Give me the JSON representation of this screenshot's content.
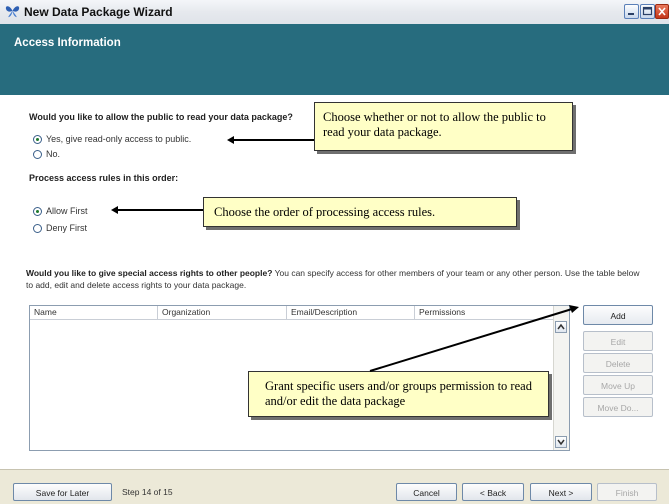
{
  "window": {
    "title": "New Data Package Wizard"
  },
  "header": {
    "title": "Access Information"
  },
  "public_access": {
    "question": "Would you like to allow the public to read your data package?",
    "options": [
      {
        "label": "Yes, give read-only access to public.",
        "checked": true
      },
      {
        "label": "No.",
        "checked": false
      }
    ]
  },
  "rule_order": {
    "question": "Process access rules in this order:",
    "options": [
      {
        "label": "Allow First",
        "checked": true
      },
      {
        "label": "Deny First",
        "checked": false
      }
    ]
  },
  "special_access": {
    "question": "Would you like to give special access rights to other people?",
    "description": " You can specify access for other members of your team or any other person. Use the table below to add, edit and delete access rights to your data package."
  },
  "table": {
    "columns": [
      "Name",
      "Organization",
      "Email/Description",
      "Permissions"
    ],
    "rows": []
  },
  "side_buttons": {
    "add": "Add",
    "edit": "Edit",
    "delete": "Delete",
    "move_up": "Move Up",
    "move_down": "Move Do..."
  },
  "callouts": {
    "public": "Choose whether or not to allow the public to read your data package.",
    "order": "Choose the order of processing access rules.",
    "grant": "Grant specific users and/or groups permission to read and/or edit the data package"
  },
  "footer": {
    "save_later": "Save for Later",
    "step": "Step 14 of 15",
    "cancel": "Cancel",
    "back": "< Back",
    "next": "Next >",
    "finish": "Finish"
  }
}
